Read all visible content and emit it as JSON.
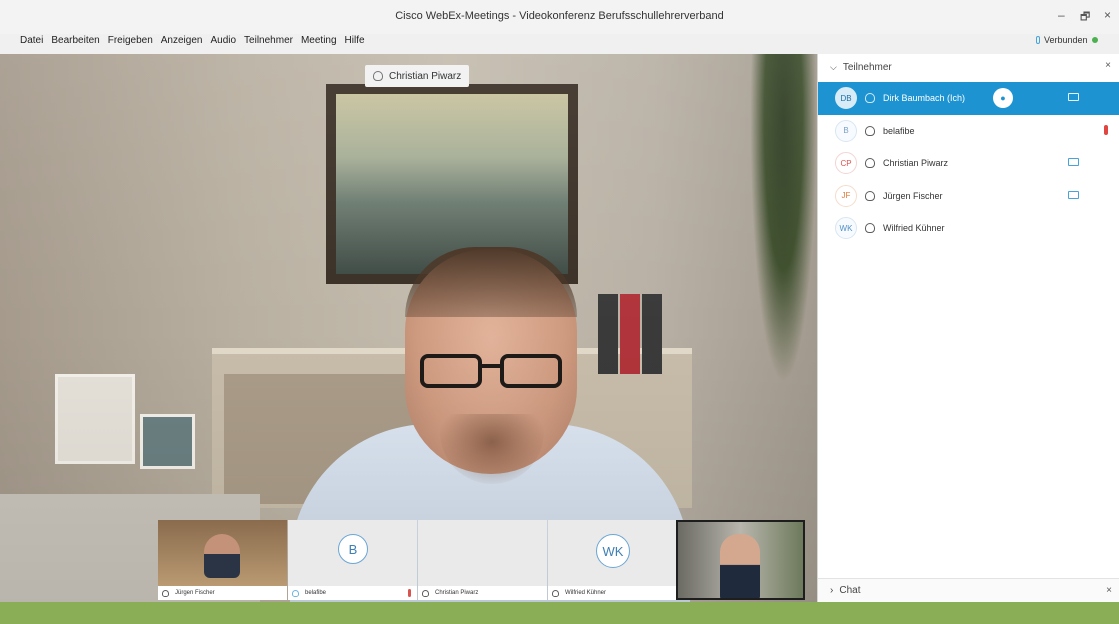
{
  "window": {
    "title": "Cisco WebEx-Meetings - Videokonferenz Berufsschullehrerverband",
    "min": "–",
    "max": "🗗",
    "close": "×"
  },
  "menu": [
    "Datei",
    "Bearbeiten",
    "Freigeben",
    "Anzeigen",
    "Audio",
    "Teilnehmer",
    "Meeting",
    "Hilfe"
  ],
  "status": {
    "label": "Verbunden",
    "color": "#4caf50"
  },
  "active_speaker": "Christian Piwarz",
  "thumbnails": [
    {
      "name": "Jürgen Fischer",
      "type": "video"
    },
    {
      "name": "belafibe",
      "type": "avatar",
      "initials": "B",
      "muted": true
    },
    {
      "name": "Christian Piwarz",
      "type": "blank"
    },
    {
      "name": "Wilfried Kühner",
      "type": "avatar",
      "initials": "WK"
    },
    {
      "name": "",
      "type": "video"
    }
  ],
  "panel": {
    "title": "Teilnehmer",
    "close": "×",
    "participants": [
      {
        "initials": "DB",
        "name": "Dirk Baumbach  (Ich)",
        "selected": true,
        "host": true,
        "camera": true
      },
      {
        "initials": "B",
        "name": "belafibe",
        "muted": true
      },
      {
        "initials": "CP",
        "name": "Christian Piwarz",
        "camera": true
      },
      {
        "initials": "JF",
        "name": "Jürgen Fischer",
        "camera": true
      },
      {
        "initials": "WK",
        "name": "Wilfried Kühner"
      }
    ],
    "chat_label": "Chat"
  },
  "colors": {
    "accent": "#1d93d2",
    "footer_band": "#8aae55"
  }
}
